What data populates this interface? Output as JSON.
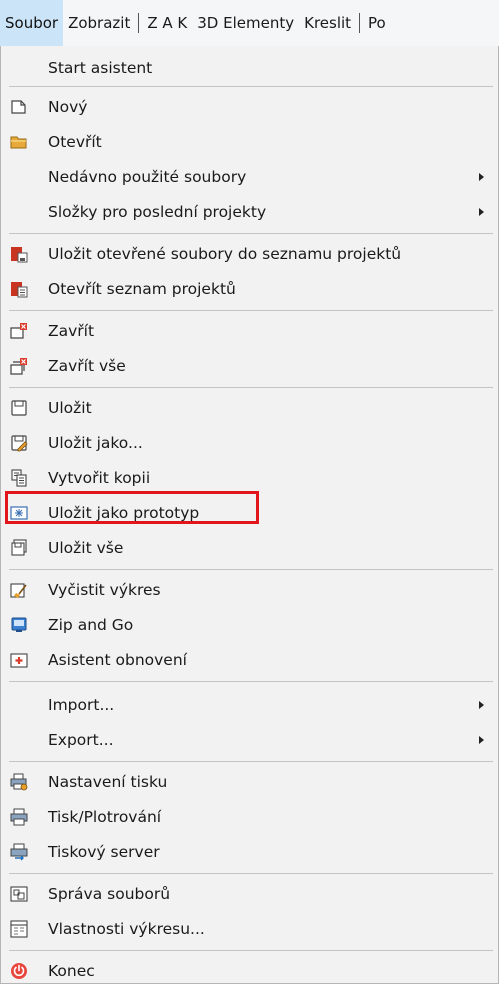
{
  "menubar": {
    "items": [
      "Soubor",
      "Zobrazit",
      "Z A K",
      "3D Elementy",
      "Kreslit",
      "Po"
    ]
  },
  "menu": {
    "start": "Start asistent",
    "new": "Nový",
    "open": "Otevřít",
    "recent_files": "Nedávno použité soubory",
    "recent_projects": "Složky pro poslední projekty",
    "save_project_list": "Uložit otevřené soubory do seznamu projektů",
    "open_project_list": "Otevřít seznam projektů",
    "close": "Zavřít",
    "close_all": "Zavřít vše",
    "save": "Uložit",
    "save_as": "Uložit jako...",
    "make_copy": "Vytvořit kopii",
    "save_prototype": "Uložit jako prototyp",
    "save_all": "Uložit vše",
    "purge": "Vyčistit výkres",
    "zip_go": "Zip and Go",
    "recovery": "Asistent obnovení",
    "import": "Import...",
    "export": "Export...",
    "print_setup": "Nastavení tisku",
    "print_plot": "Tisk/Plotrování",
    "print_server": "Tiskový server",
    "file_manager": "Správa souborů",
    "drawing_props": "Vlastnosti výkresu...",
    "exit": "Konec"
  },
  "icons": {
    "new": "new-document-icon",
    "open": "folder-open-icon",
    "save_project_list": "save-project-list-icon",
    "open_project_list": "open-project-list-icon",
    "close": "close-document-icon",
    "close_all": "close-all-icon",
    "save": "save-icon",
    "save_as": "save-as-icon",
    "make_copy": "copy-icon",
    "save_prototype": "prototype-icon",
    "save_all": "save-all-icon",
    "purge": "purge-icon",
    "zip_go": "zip-icon",
    "recovery": "recovery-icon",
    "print_setup": "print-setup-icon",
    "print_plot": "printer-icon",
    "print_server": "print-server-icon",
    "file_manager": "file-manager-icon",
    "drawing_props": "drawing-properties-icon",
    "exit": "power-icon"
  },
  "colors": {
    "active_menu": "#cce4f7",
    "highlight_box": "#e0161c",
    "accent_red": "#c8341f",
    "folder": "#e7a93a",
    "power": "#e8463c"
  }
}
